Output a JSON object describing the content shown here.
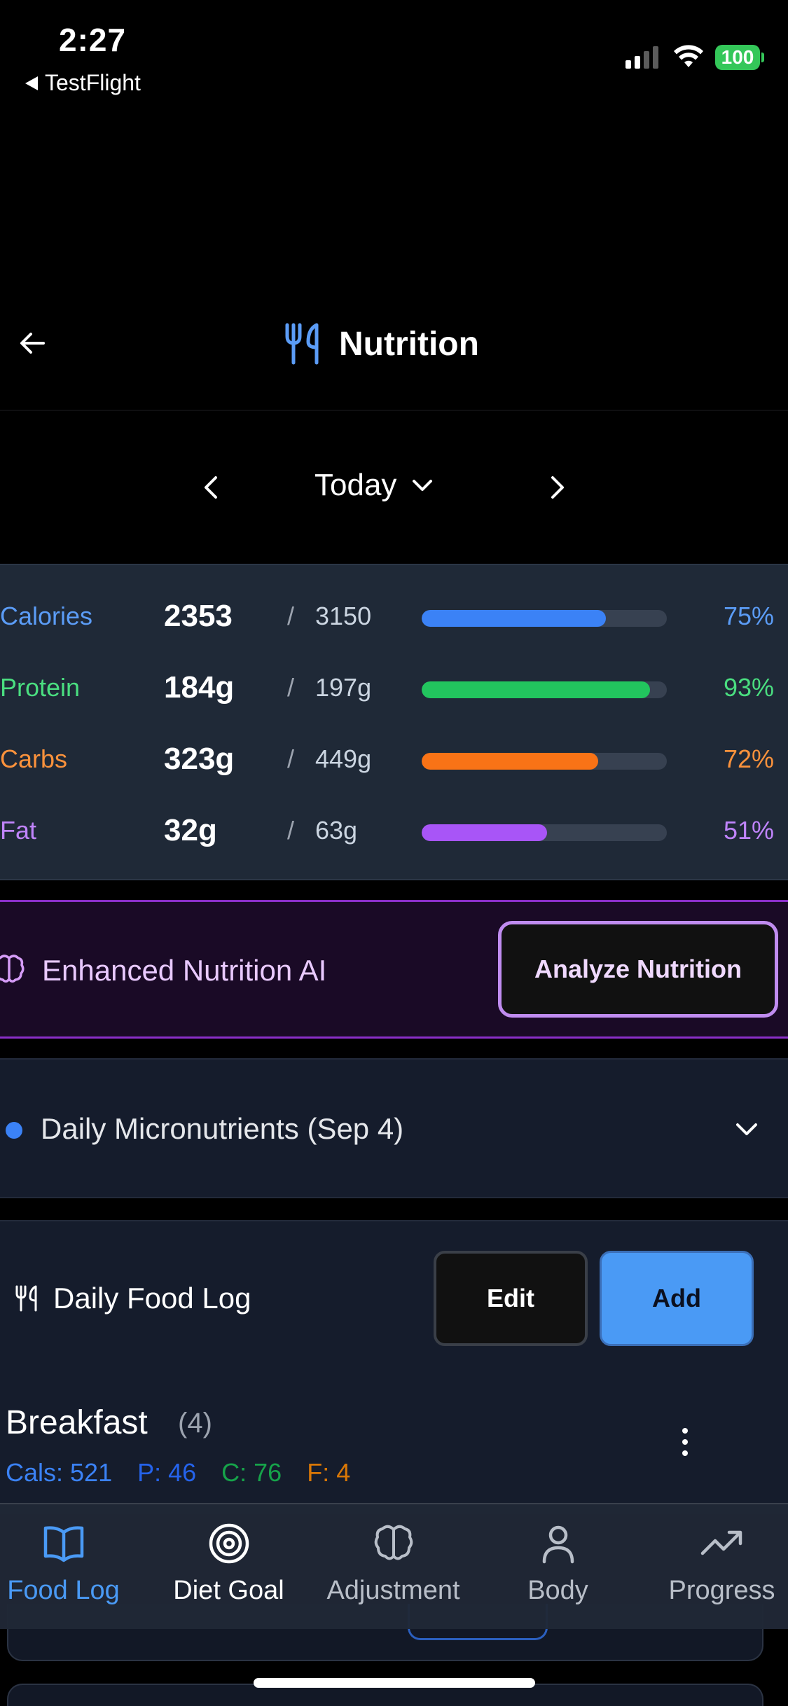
{
  "status_bar": {
    "time": "2:27",
    "back_app": "TestFlight",
    "battery": "100",
    "colors": {
      "battery": "#34c759"
    }
  },
  "header": {
    "title": "Nutrition",
    "icon": "fork-knife-icon"
  },
  "date_nav": {
    "label": "Today"
  },
  "macros": [
    {
      "name": "Calories",
      "value": "2353",
      "goal": "3150",
      "percent_label": "75%",
      "fraction": 0.75,
      "color": "#5b9cf6",
      "bar_color": "#3b82f6"
    },
    {
      "name": "Protein",
      "value": "184g",
      "goal": "197g",
      "percent_label": "93%",
      "fraction": 0.93,
      "color": "#4ade80",
      "bar_color": "#22c55e"
    },
    {
      "name": "Carbs",
      "value": "323g",
      "goal": "449g",
      "percent_label": "72%",
      "fraction": 0.72,
      "color": "#fb923c",
      "bar_color": "#f97316"
    },
    {
      "name": "Fat",
      "value": "32g",
      "goal": "63g",
      "percent_label": "51%",
      "fraction": 0.51,
      "color": "#c084fc",
      "bar_color": "#a855f7"
    }
  ],
  "ai_panel": {
    "label": "Enhanced Nutrition AI",
    "button": "Analyze Nutrition",
    "icon": "brain-icon"
  },
  "micronutrients": {
    "label": "Daily Micronutrients (Sep 4)"
  },
  "food_log": {
    "title": "Daily Food Log",
    "edit_label": "Edit",
    "add_label": "Add",
    "meals": [
      {
        "name": "Breakfast",
        "count": "(4)",
        "cals": "Cals: 521",
        "protein": "P: 46",
        "carbs": "C: 76",
        "fat": "F: 4"
      }
    ]
  },
  "tabs": [
    {
      "label": "Food Log",
      "icon": "book-icon",
      "active": true
    },
    {
      "label": "Diet Goal",
      "icon": "target-icon",
      "active": false
    },
    {
      "label": "Adjustment",
      "icon": "brain-icon",
      "active": false
    },
    {
      "label": "Body",
      "icon": "person-icon",
      "active": false
    },
    {
      "label": "Progress",
      "icon": "trending-up-icon",
      "active": false
    }
  ]
}
